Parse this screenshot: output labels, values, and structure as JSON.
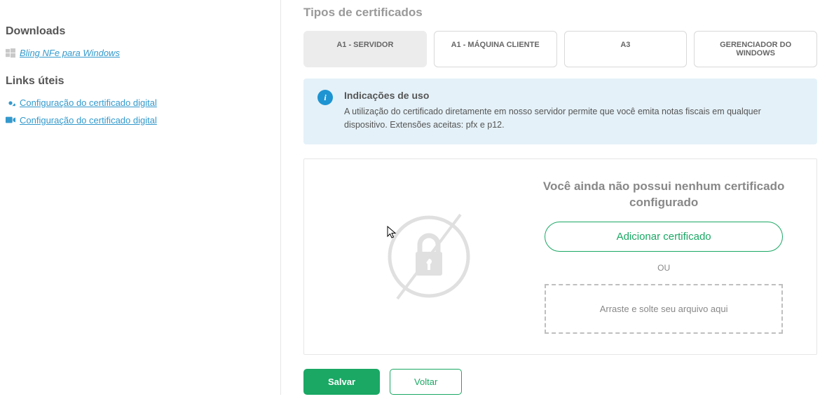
{
  "sidebar": {
    "downloads_heading": "Downloads",
    "download_link": "Bling NFe para Windows",
    "links_heading": "Links úteis",
    "links": [
      {
        "label": "Configuração do certificado digital"
      },
      {
        "label": "Configuração do certificado digital"
      }
    ]
  },
  "main": {
    "title": "Tipos de certificados",
    "tabs": [
      {
        "label": "A1 - SERVIDOR",
        "active": true
      },
      {
        "label": "A1 - MÁQUINA CLIENTE",
        "active": false
      },
      {
        "label": "A3",
        "active": false
      },
      {
        "label": "GERENCIADOR DO WINDOWS",
        "active": false
      }
    ],
    "info": {
      "title": "Indicações de uso",
      "text": "A utilização do certificado diretamente em nosso servidor permite que você emita notas fiscais em qualquer dispositivo. Extensões aceitas: pfx e p12."
    },
    "empty_state": {
      "title": "Você ainda não possui nenhum certificado configurado",
      "add_button": "Adicionar certificado",
      "or": "OU",
      "dropzone": "Arraste e solte seu arquivo aqui"
    }
  },
  "footer": {
    "save": "Salvar",
    "back": "Voltar"
  }
}
